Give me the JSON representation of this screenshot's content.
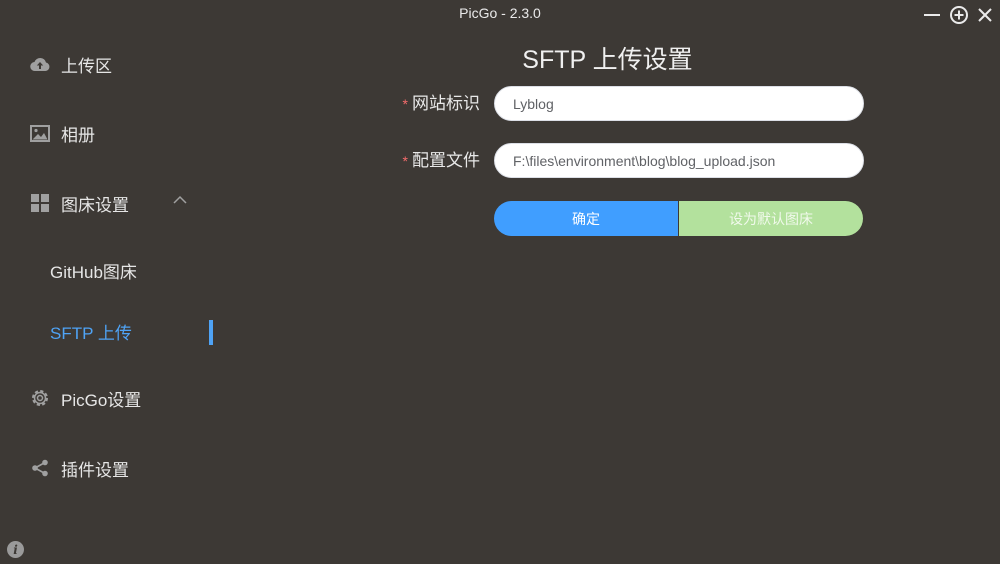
{
  "window": {
    "title": "PicGo - 2.3.0"
  },
  "sidebar": {
    "items": [
      {
        "label": "上传区",
        "icon": "cloud-upload-icon"
      },
      {
        "label": "相册",
        "icon": "image-icon"
      },
      {
        "label": "图床设置",
        "icon": "grid-icon",
        "expanded": true
      },
      {
        "label": "PicGo设置",
        "icon": "gear-icon"
      },
      {
        "label": "插件设置",
        "icon": "share-icon"
      }
    ],
    "sub_items": [
      {
        "label": "GitHub图床",
        "active": false
      },
      {
        "label": "SFTP 上传",
        "active": true
      }
    ]
  },
  "main": {
    "title": "SFTP 上传设置",
    "fields": [
      {
        "required_mark": "*",
        "label": "网站标识",
        "value": "Lyblog"
      },
      {
        "required_mark": "*",
        "label": "配置文件",
        "value": "F:\\files\\environment\\blog\\blog_upload.json"
      }
    ],
    "confirm_label": "确定",
    "set_default_label": "设为默认图床"
  },
  "colors": {
    "background": "#3d3935",
    "accent": "#409eff",
    "success_light": "#b3e19d",
    "required": "#f56c6c"
  }
}
